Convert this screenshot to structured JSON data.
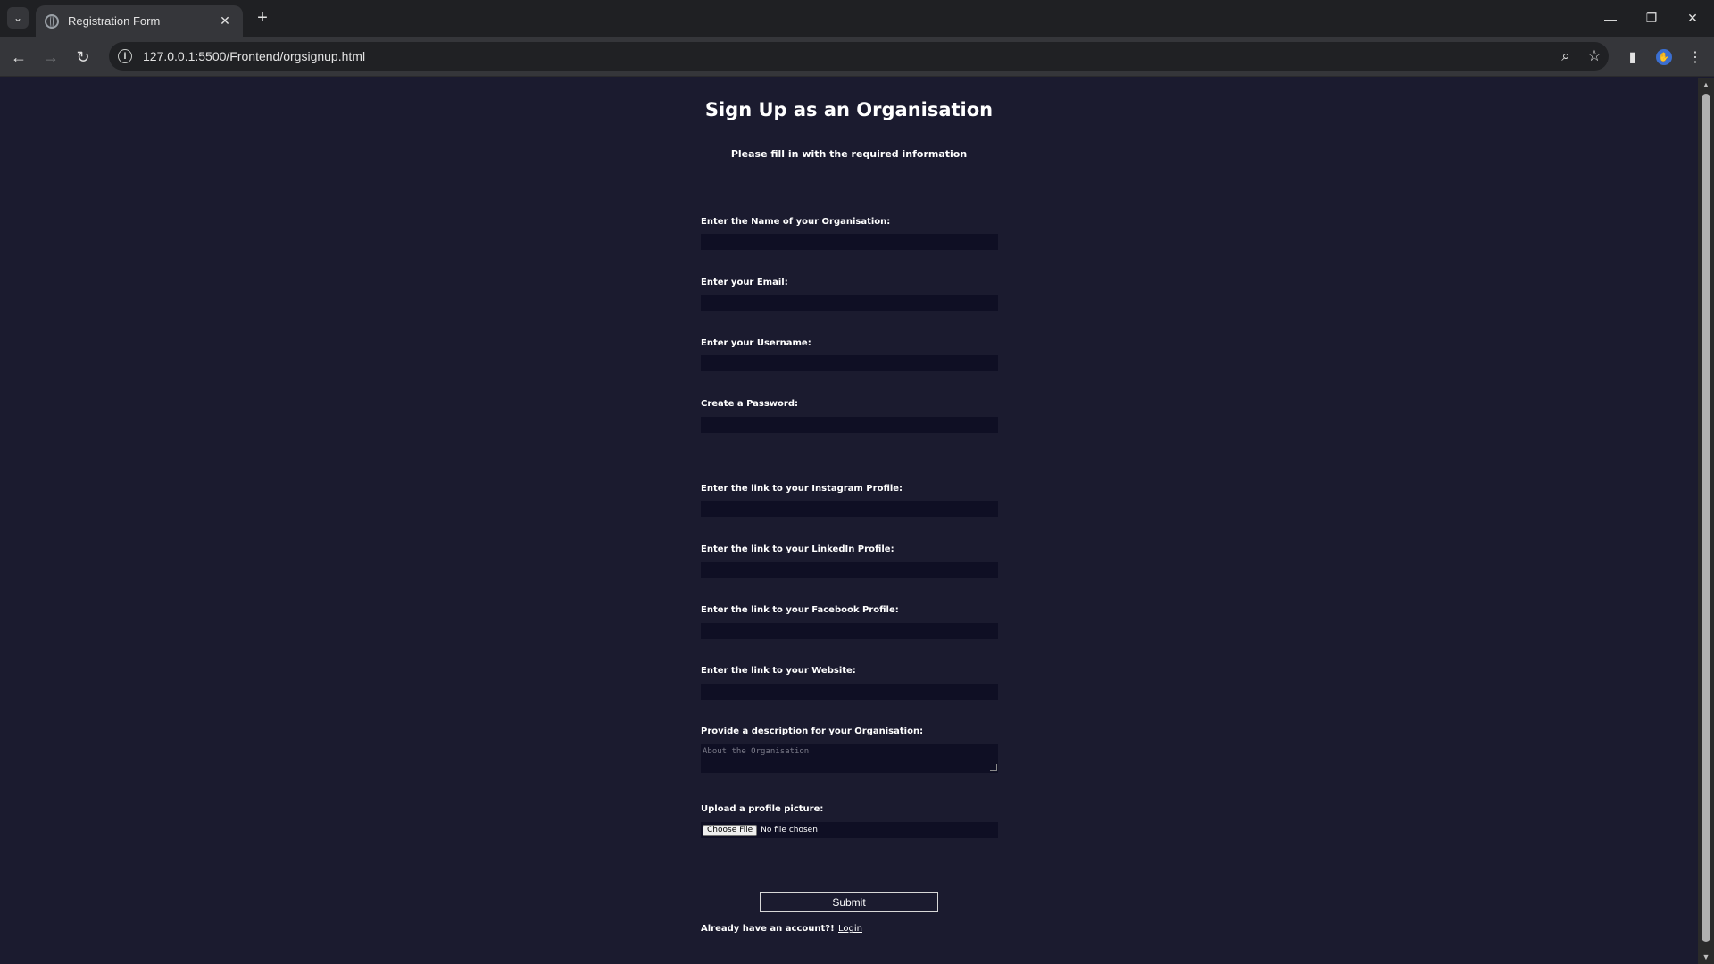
{
  "browser": {
    "tab_title": "Registration Form",
    "url": "127.0.0.1:5500/Frontend/orgsignup.html"
  },
  "page": {
    "title": "Sign Up as an Organisation",
    "subtitle": "Please fill in with the required information"
  },
  "fields": {
    "org_name": {
      "label": "Enter the Name of your Organisation:",
      "value": ""
    },
    "email": {
      "label": "Enter your Email:",
      "value": ""
    },
    "username": {
      "label": "Enter your Username:",
      "value": ""
    },
    "password": {
      "label": "Create a Password:",
      "value": ""
    },
    "instagram": {
      "label": "Enter the link to your Instagram Profile:",
      "value": ""
    },
    "linkedin": {
      "label": "Enter the link to your LinkedIn Profile:",
      "value": ""
    },
    "facebook": {
      "label": "Enter the link to your Facebook Profile:",
      "value": ""
    },
    "website": {
      "label": "Enter the link to your Website:",
      "value": ""
    },
    "description": {
      "label": "Provide a description for your Organisation:",
      "placeholder": "About the Organisation"
    },
    "picture": {
      "label": "Upload a profile picture:",
      "button": "Choose File",
      "status": "No file chosen"
    }
  },
  "actions": {
    "submit": "Submit",
    "account_prompt": "Already have an account?!",
    "login": "Login"
  }
}
